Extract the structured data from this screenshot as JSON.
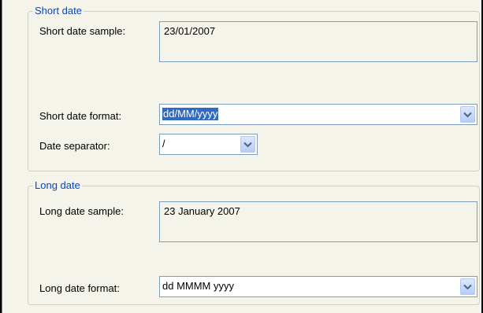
{
  "short_date": {
    "title": "Short date",
    "sample_label": "Short date sample:",
    "sample_value": "23/01/2007",
    "format_label": "Short date format:",
    "format_value": "dd/MM/yyyy",
    "separator_label": "Date separator:",
    "separator_value": "/"
  },
  "long_date": {
    "title": "Long date",
    "sample_label": "Long date sample:",
    "sample_value": "23 January 2007",
    "format_label": "Long date format:",
    "format_value": "dd MMMM yyyy"
  },
  "icons": {
    "dropdown": "chevron-down-icon"
  },
  "colors": {
    "group_title": "#0046d5",
    "selection": "#316ac5",
    "panel": "#f5f4ea"
  }
}
